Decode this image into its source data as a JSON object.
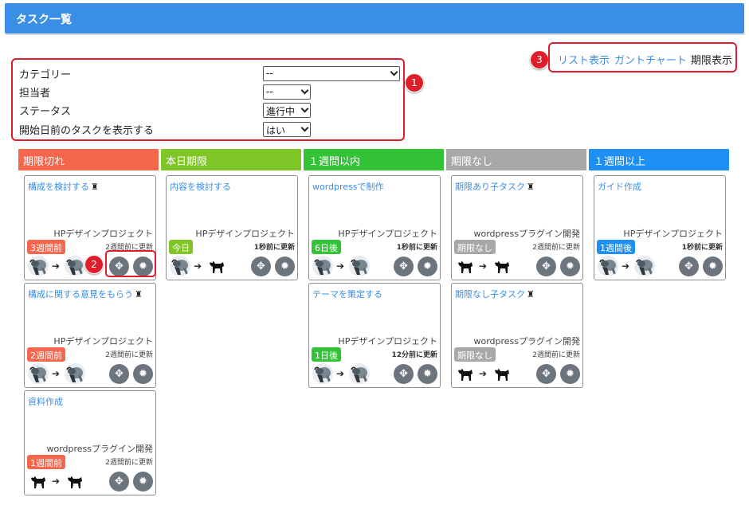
{
  "header": {
    "title": "タスク一覧"
  },
  "filters": {
    "category_label": "カテゴリー",
    "category_value": "--",
    "assignee_label": "担当者",
    "assignee_value": "--",
    "status_label": "ステータス",
    "status_value": "進行中",
    "show_before_start_label": "開始日前のタスクを表示する",
    "show_before_start_value": "はい"
  },
  "callouts": {
    "one": "1",
    "two": "2",
    "three": "3"
  },
  "view_nav": {
    "list": "リスト表示",
    "gantt": "ガントチャート",
    "deadline": "期限表示"
  },
  "columns": [
    {
      "label": "期限切れ",
      "color": "#f4674d"
    },
    {
      "label": "本日期限",
      "color": "#80c526"
    },
    {
      "label": "１週間以内",
      "color": "#34c337"
    },
    {
      "label": "期限なし",
      "color": "#a8a8a8"
    },
    {
      "label": "１週間以上",
      "color": "#1e90f5"
    }
  ],
  "cards": {
    "c0_0": {
      "title": "構成を検討する",
      "pin": "♜",
      "project": "HPデザインプロジェクト",
      "updated": "2週間前に更新",
      "due": "3週間前"
    },
    "c0_1": {
      "title": "構成に関する意見をもらう",
      "pin": "♜",
      "project": "HPデザインプロジェクト",
      "updated": "2週間前に更新",
      "due": "2週間前"
    },
    "c0_2": {
      "title": "資料作成",
      "project": "wordpressプラグイン開発",
      "updated": "2週間前に更新",
      "due": "1週間前"
    },
    "c1_0": {
      "title": "内容を検討する",
      "project": "HPデザインプロジェクト",
      "updated": "1秒前に更新",
      "due": "今日"
    },
    "c2_0": {
      "title": "wordpressで制作",
      "project": "HPデザインプロジェクト",
      "updated": "1秒前に更新",
      "due": "6日後"
    },
    "c2_1": {
      "title": "テーマを策定する",
      "project": "HPデザインプロジェクト",
      "updated": "12分前に更新",
      "due": "1日後"
    },
    "c3_0": {
      "title": "期限あり子タスク",
      "pin": "♜",
      "project": "wordpressプラグイン開発",
      "updated": "2週間前に更新",
      "due": "期限なし"
    },
    "c3_1": {
      "title": "期限なし子タスク",
      "pin": "♜",
      "project": "wordpressプラグイン開発",
      "updated": "2週間前に更新",
      "due": "期限なし"
    },
    "c4_0": {
      "title": "ガイド作成",
      "project": "HPデザインプロジェクト",
      "updated": "1秒前に更新",
      "due": "1週間後"
    }
  },
  "icons": {
    "move": "move-arrows-icon",
    "settings": "gear-icon",
    "arrow": "right-arrow-icon",
    "pin": "pin-icon"
  },
  "arrow_glyph": "➔",
  "move_glyph": "✥",
  "gear_glyph": "✹"
}
